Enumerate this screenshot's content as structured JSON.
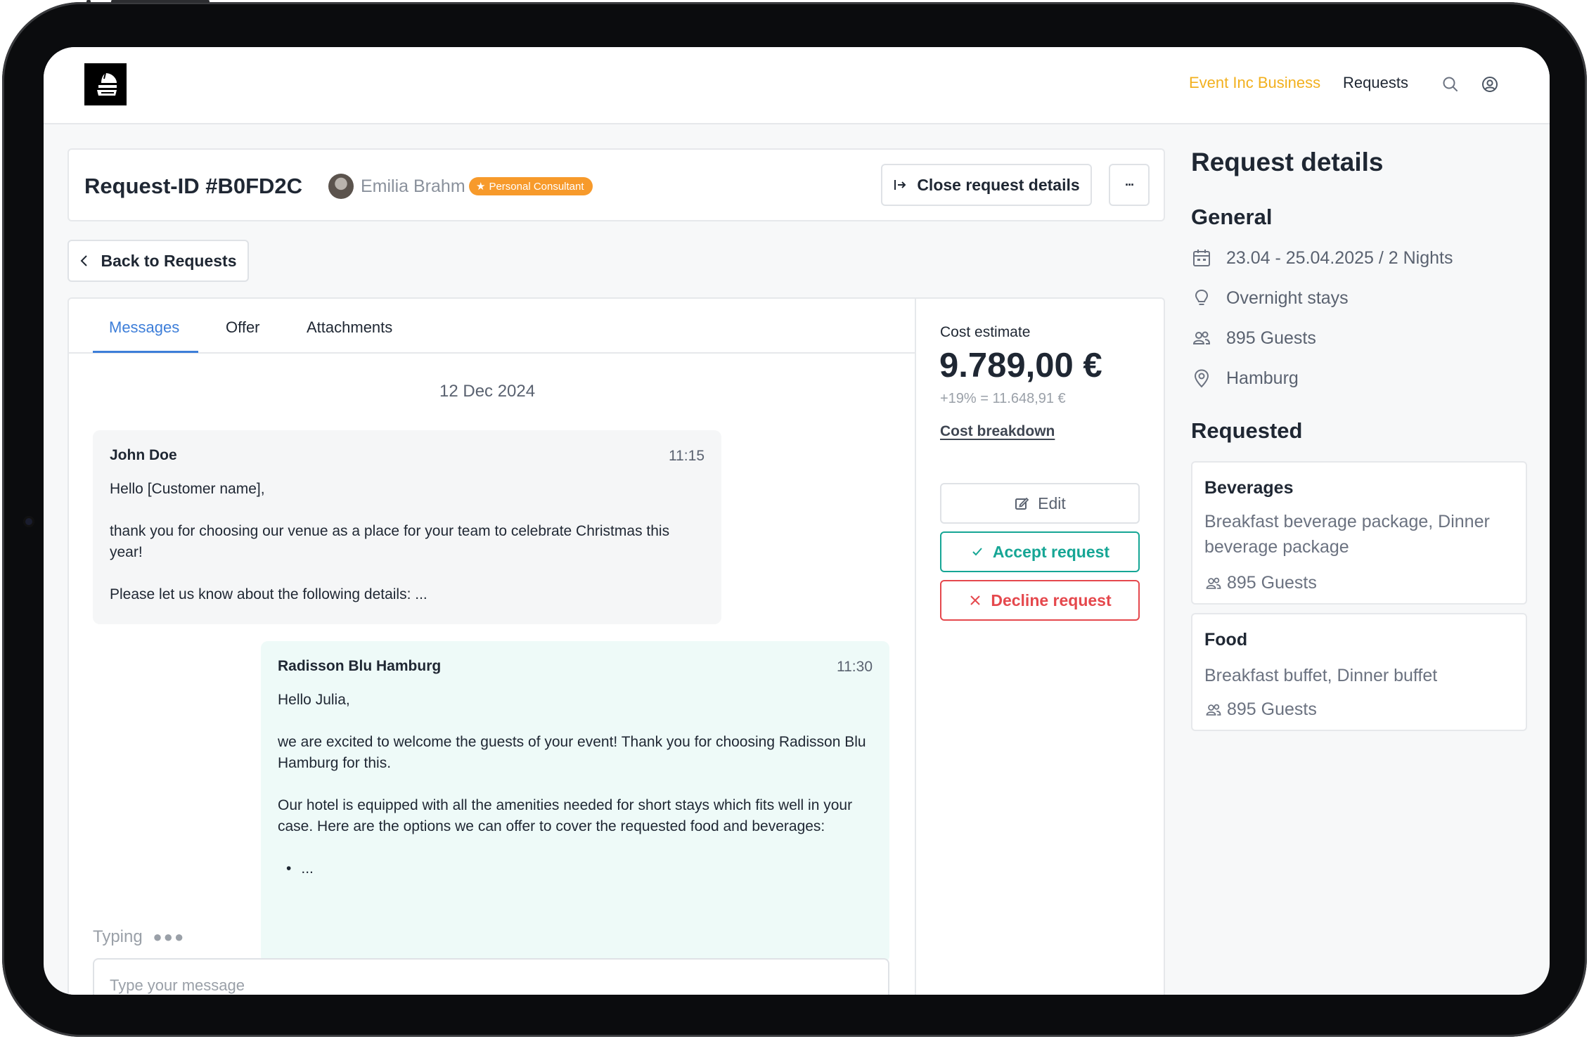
{
  "header": {
    "brand_link": "Event Inc Business",
    "requests_link": "Requests",
    "icons": [
      "search-icon",
      "user-icon"
    ]
  },
  "request": {
    "id": "Request-ID #B0FD2C",
    "consultant_name": "Emilia Brahm",
    "consultant_badge": "Personal Consultant",
    "close_label": "Close request details",
    "more_label": "···"
  },
  "back_label": "Back to Requests",
  "tabs": [
    {
      "label": "Messages",
      "active": true
    },
    {
      "label": "Offer",
      "active": false
    },
    {
      "label": "Attachments",
      "active": false
    }
  ],
  "messages": {
    "date": "12 Dec 2024",
    "items": [
      {
        "author": "John Doe",
        "time": "11:15",
        "lines": [
          "Hello [Customer name],",
          "thank you for choosing our venue as a place for your team to celebrate Christmas this year!",
          "Please let us know about the following details: ..."
        ]
      },
      {
        "author": "Radisson Blu Hamburg",
        "time": "11:30",
        "lines": [
          "Hello Julia,",
          "we are excited to welcome the guests of your event! Thank you for choosing Radisson Blu Hamburg for this.",
          "Our hotel is equipped with all the amenities needed for short stays which fits well in your case. Here are the options we can offer to cover the requested food and beverages:"
        ],
        "bullet": "..."
      }
    ],
    "typing": "Typing",
    "input_placeholder": "Type your message"
  },
  "cost": {
    "label": "Cost estimate",
    "amount": "9.789,00 €",
    "tax_line": "+19% = 11.648,91 €",
    "breakdown_link": "Cost breakdown",
    "edit_label": "Edit",
    "accept_label": "Accept request",
    "decline_label": "Decline request"
  },
  "details": {
    "title": "Request details",
    "general_heading": "General",
    "general": [
      {
        "icon": "calendar-icon",
        "text": "23.04 - 25.04.2025 / 2 Nights"
      },
      {
        "icon": "lightbulb-icon",
        "text": "Overnight stays"
      },
      {
        "icon": "users-icon",
        "text": "895 Guests"
      },
      {
        "icon": "location-pin-icon",
        "text": "Hamburg"
      }
    ],
    "requested_heading": "Requested",
    "requested": [
      {
        "title": "Beverages",
        "description": "Breakfast beverage package, Dinner beverage package",
        "guests": "895 Guests"
      },
      {
        "title": "Food",
        "description": "Breakfast buffet, Dinner buffet",
        "guests": "895 Guests"
      }
    ]
  },
  "colors": {
    "brand_yellow": "#f2b01e",
    "active_tab_blue": "#3d7ed9",
    "accept_teal": "#16a695",
    "decline_red": "#e5484d",
    "badge_orange": "#f79a2b",
    "reply_bubble": "#eefaf8"
  }
}
